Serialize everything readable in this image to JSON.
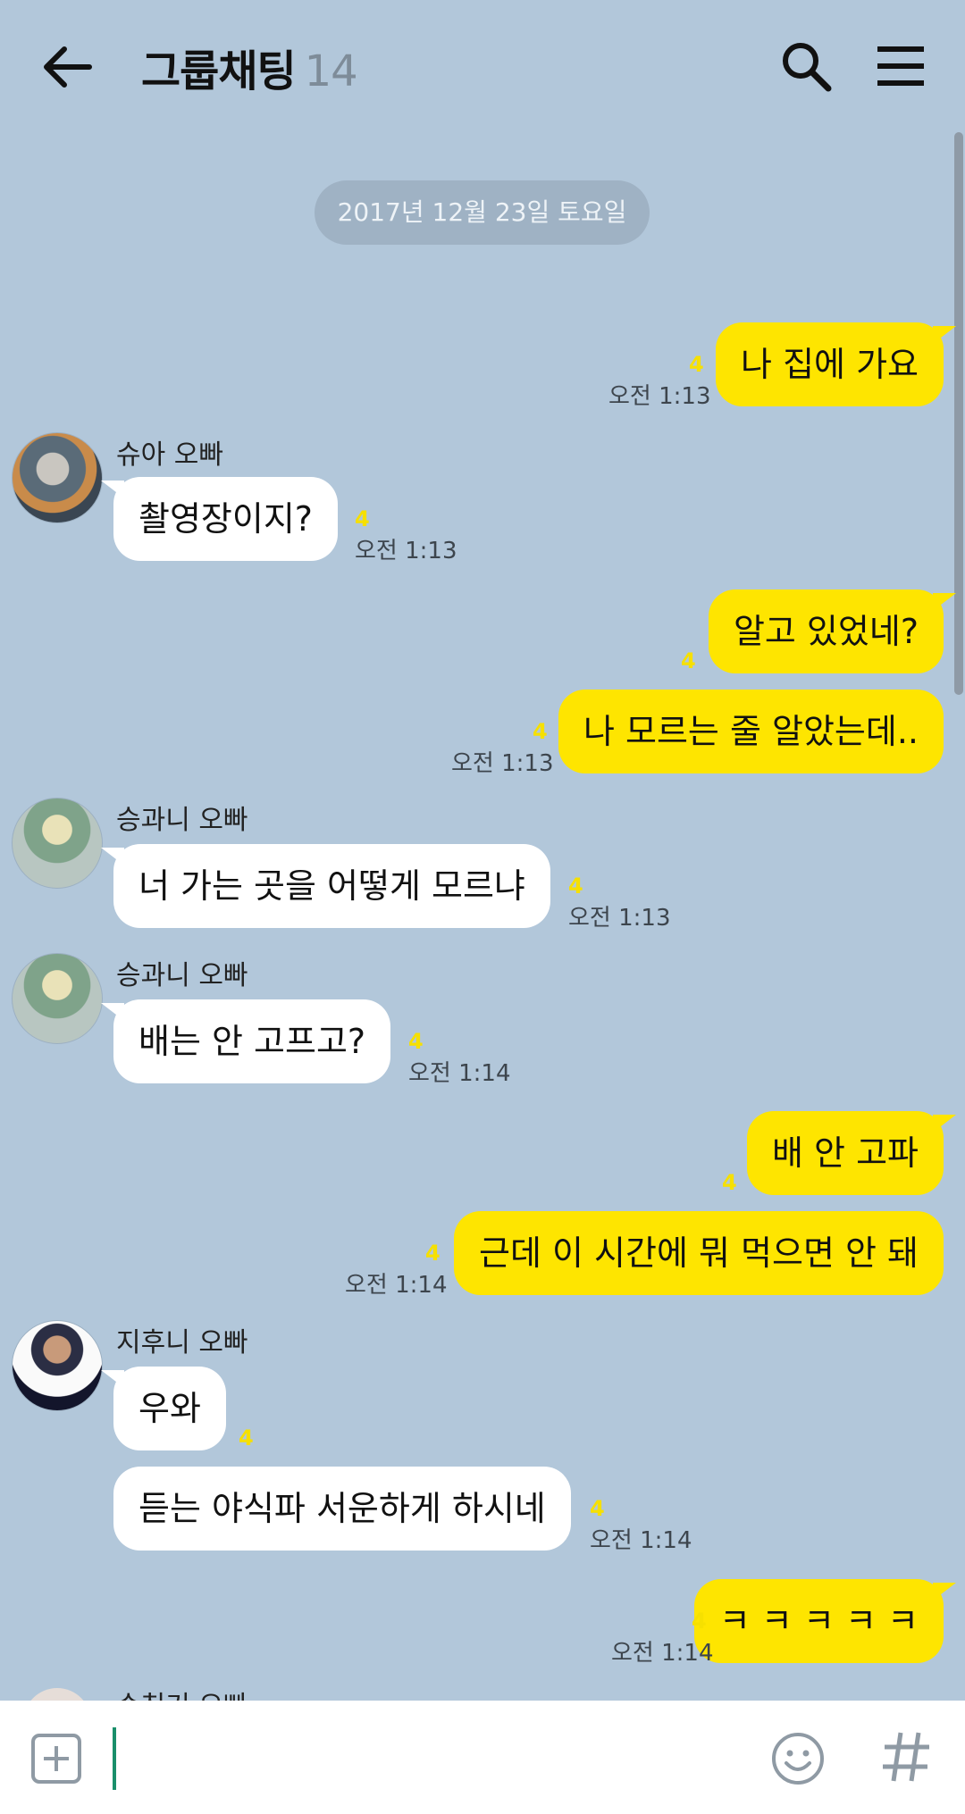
{
  "header": {
    "title": "그룹채팅",
    "member_count": "14"
  },
  "date_divider": "2017년 12월 23일 토요일",
  "messages": [
    {
      "sender": "me",
      "text": "나 집에 가요",
      "unread": "4",
      "time": "오전 1:13"
    },
    {
      "sender": "슈아 오빠",
      "text": "촬영장이지?",
      "unread": "4",
      "time": "오전 1:13"
    },
    {
      "sender": "me",
      "text": "알고 있었네?",
      "unread": "4",
      "time": ""
    },
    {
      "sender": "me",
      "text": "나 모르는 줄 알았는데..",
      "unread": "4",
      "time": "오전 1:13"
    },
    {
      "sender": "승과니 오빠",
      "text": "너 가는 곳을 어떻게 모르냐",
      "unread": "4",
      "time": "오전 1:13"
    },
    {
      "sender": "승과니 오빠",
      "text": "배는 안 고프고?",
      "unread": "4",
      "time": "오전 1:14"
    },
    {
      "sender": "me",
      "text": "배 안 고파",
      "unread": "4",
      "time": ""
    },
    {
      "sender": "me",
      "text": "근데 이 시간에 뭐 먹으면 안 돼",
      "unread": "4",
      "time": "오전 1:14"
    },
    {
      "sender": "지후니 오빠",
      "text": "우와",
      "unread": "4",
      "time": ""
    },
    {
      "sender": "지후니 오빠",
      "text": "듣는 야식파 서운하게 하시네",
      "unread": "4",
      "time": "오전 1:14"
    },
    {
      "sender": "me",
      "text": "ㅋ ㅋ ㅋ ㅋ ㅋ",
      "unread": "4",
      "time": "오전 1:14"
    }
  ],
  "partial_sender": "순친기 오빠",
  "icons": {
    "back": "arrow-left-icon",
    "search": "search-icon",
    "menu": "hamburger-menu-icon",
    "attach": "plus-square-icon",
    "emoji": "smiley-icon",
    "hashtag": "hash-icon"
  },
  "colors": {
    "background": "#b2c7da",
    "my_bubble": "#fee500",
    "other_bubble": "#ffffff",
    "unread": "#f6e000"
  }
}
